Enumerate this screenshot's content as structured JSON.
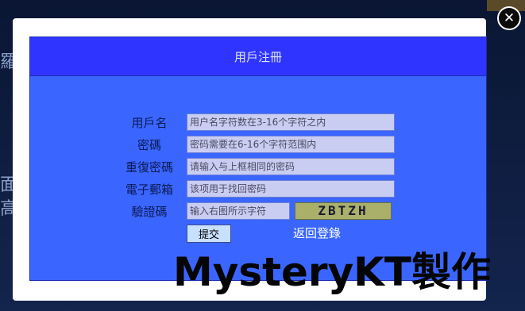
{
  "background": {
    "chars": [
      "羅",
      "面",
      "高"
    ]
  },
  "dialog": {
    "title": "用戶注冊",
    "fields": [
      {
        "label": "用戶名",
        "placeholder": "用户名字符数在3-16个字符之内"
      },
      {
        "label": "密碼",
        "placeholder": "密码需要在6-16个字符范围内"
      },
      {
        "label": "重復密碼",
        "placeholder": "请输入与上框相同的密码"
      },
      {
        "label": "電子郵箱",
        "placeholder": "该项用于找回密码"
      },
      {
        "label": "驗證碼",
        "placeholder": "输入右图所示字符"
      }
    ],
    "captcha_text": "ZBTZH",
    "submit_label": "提交",
    "back_label": "返回登錄"
  },
  "close_icon_glyph": "✕",
  "watermark": "MysteryKT製作",
  "colors": {
    "panel": "#3a66ff",
    "header": "#2f35ff",
    "field": "#c9cdf2",
    "label": "#0c1a55"
  }
}
